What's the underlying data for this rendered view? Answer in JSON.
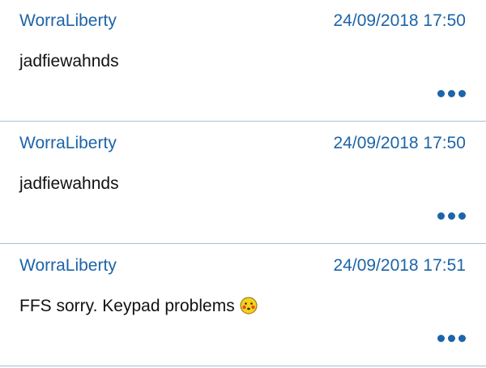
{
  "posts": [
    {
      "author": "WorraLiberty",
      "timestamp": "24/09/2018 17:50",
      "body": "jadfiewahnds",
      "emoji": null
    },
    {
      "author": "WorraLiberty",
      "timestamp": "24/09/2018 17:50",
      "body": "jadfiewahnds",
      "emoji": null
    },
    {
      "author": "WorraLiberty",
      "timestamp": "24/09/2018 17:51",
      "body": "FFS sorry. Keypad problems",
      "emoji": "blushing-face-icon"
    }
  ],
  "colors": {
    "link": "#1d64a8",
    "text": "#111111",
    "divider": "#a9bfd6",
    "emoji_face": "#f6d21c",
    "emoji_cheeks": "#e8482c"
  }
}
